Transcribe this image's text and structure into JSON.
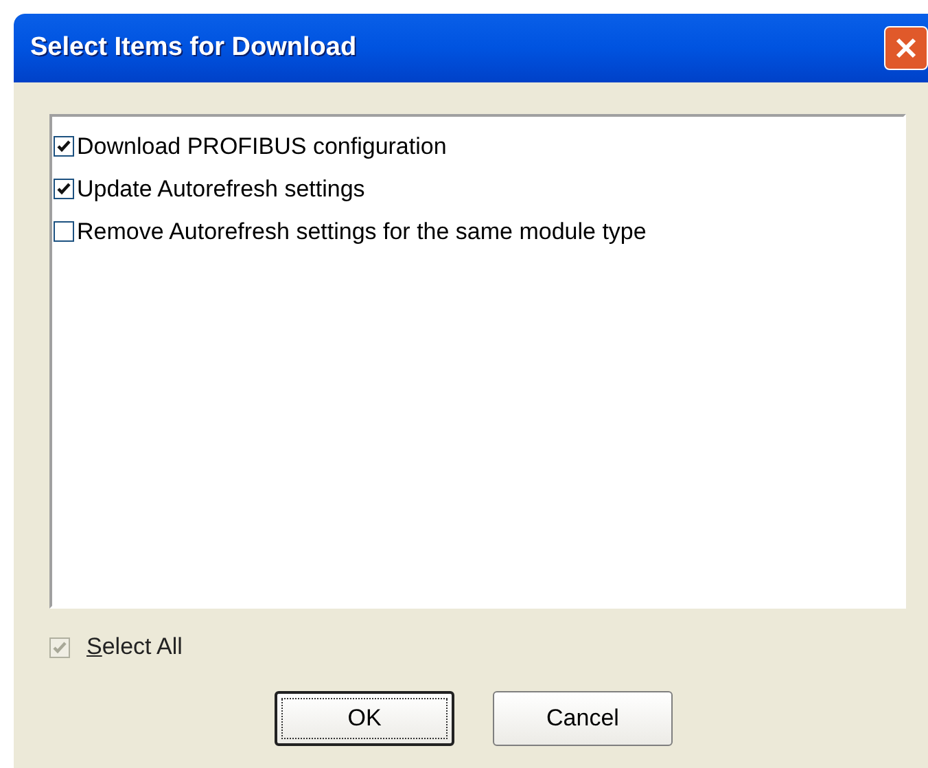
{
  "window": {
    "title": "Select Items for Download"
  },
  "items": [
    {
      "label": "Download PROFIBUS configuration",
      "checked": true
    },
    {
      "label": "Update Autorefresh settings",
      "checked": true
    },
    {
      "label": "Remove Autorefresh settings for the same module type",
      "checked": false
    }
  ],
  "select_all": {
    "label": "Select All",
    "mnemonic_underlined": true,
    "checked": true,
    "disabled": true
  },
  "buttons": [
    {
      "label": "OK",
      "default": true
    },
    {
      "label": "Cancel",
      "default": false
    }
  ]
}
